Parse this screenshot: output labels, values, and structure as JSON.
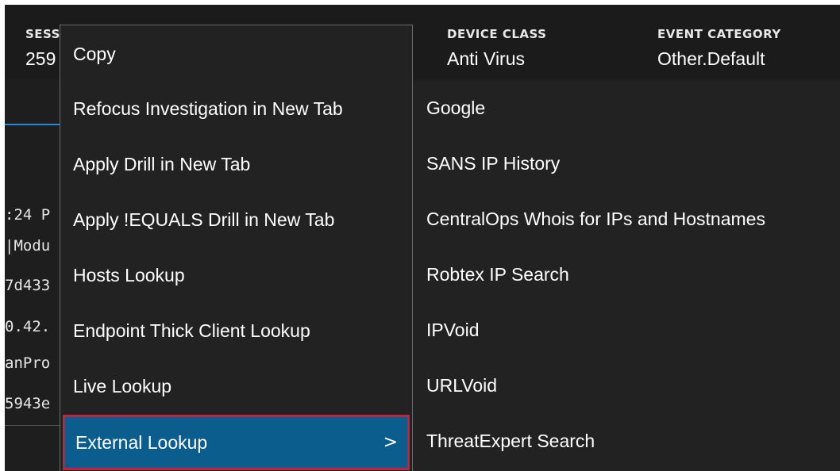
{
  "header": {
    "session": {
      "label": "SESS",
      "value": "259"
    },
    "device_class": {
      "label": "DEVICE CLASS",
      "value": "Anti Virus"
    },
    "event_category": {
      "label": "EVENT CATEGORY",
      "value": "Other.Default"
    }
  },
  "log_fragments": [
    ":24 P",
    "|Modu",
    "7d433",
    "0.42.",
    "anPro",
    "5943e"
  ],
  "context_menu": {
    "items": [
      {
        "label": "Copy"
      },
      {
        "label": "Refocus Investigation in New Tab"
      },
      {
        "label": "Apply Drill in New Tab"
      },
      {
        "label": "Apply !EQUALS Drill in New Tab"
      },
      {
        "label": "Hosts Lookup"
      },
      {
        "label": "Endpoint Thick Client Lookup"
      },
      {
        "label": "Live Lookup"
      },
      {
        "label": "External Lookup",
        "active": true,
        "has_submenu": true
      }
    ],
    "chevron_icon": "chevron-right-icon",
    "chevron_glyph": ">",
    "highlight_color": "#0a5d8d",
    "highlight_border_color": "#c8203a"
  },
  "submenu": {
    "items": [
      {
        "label": "Google"
      },
      {
        "label": "SANS IP History"
      },
      {
        "label": "CentralOps Whois for IPs and Hostnames"
      },
      {
        "label": "Robtex IP Search"
      },
      {
        "label": "IPVoid"
      },
      {
        "label": "URLVoid"
      },
      {
        "label": "ThreatExpert Search"
      }
    ]
  }
}
